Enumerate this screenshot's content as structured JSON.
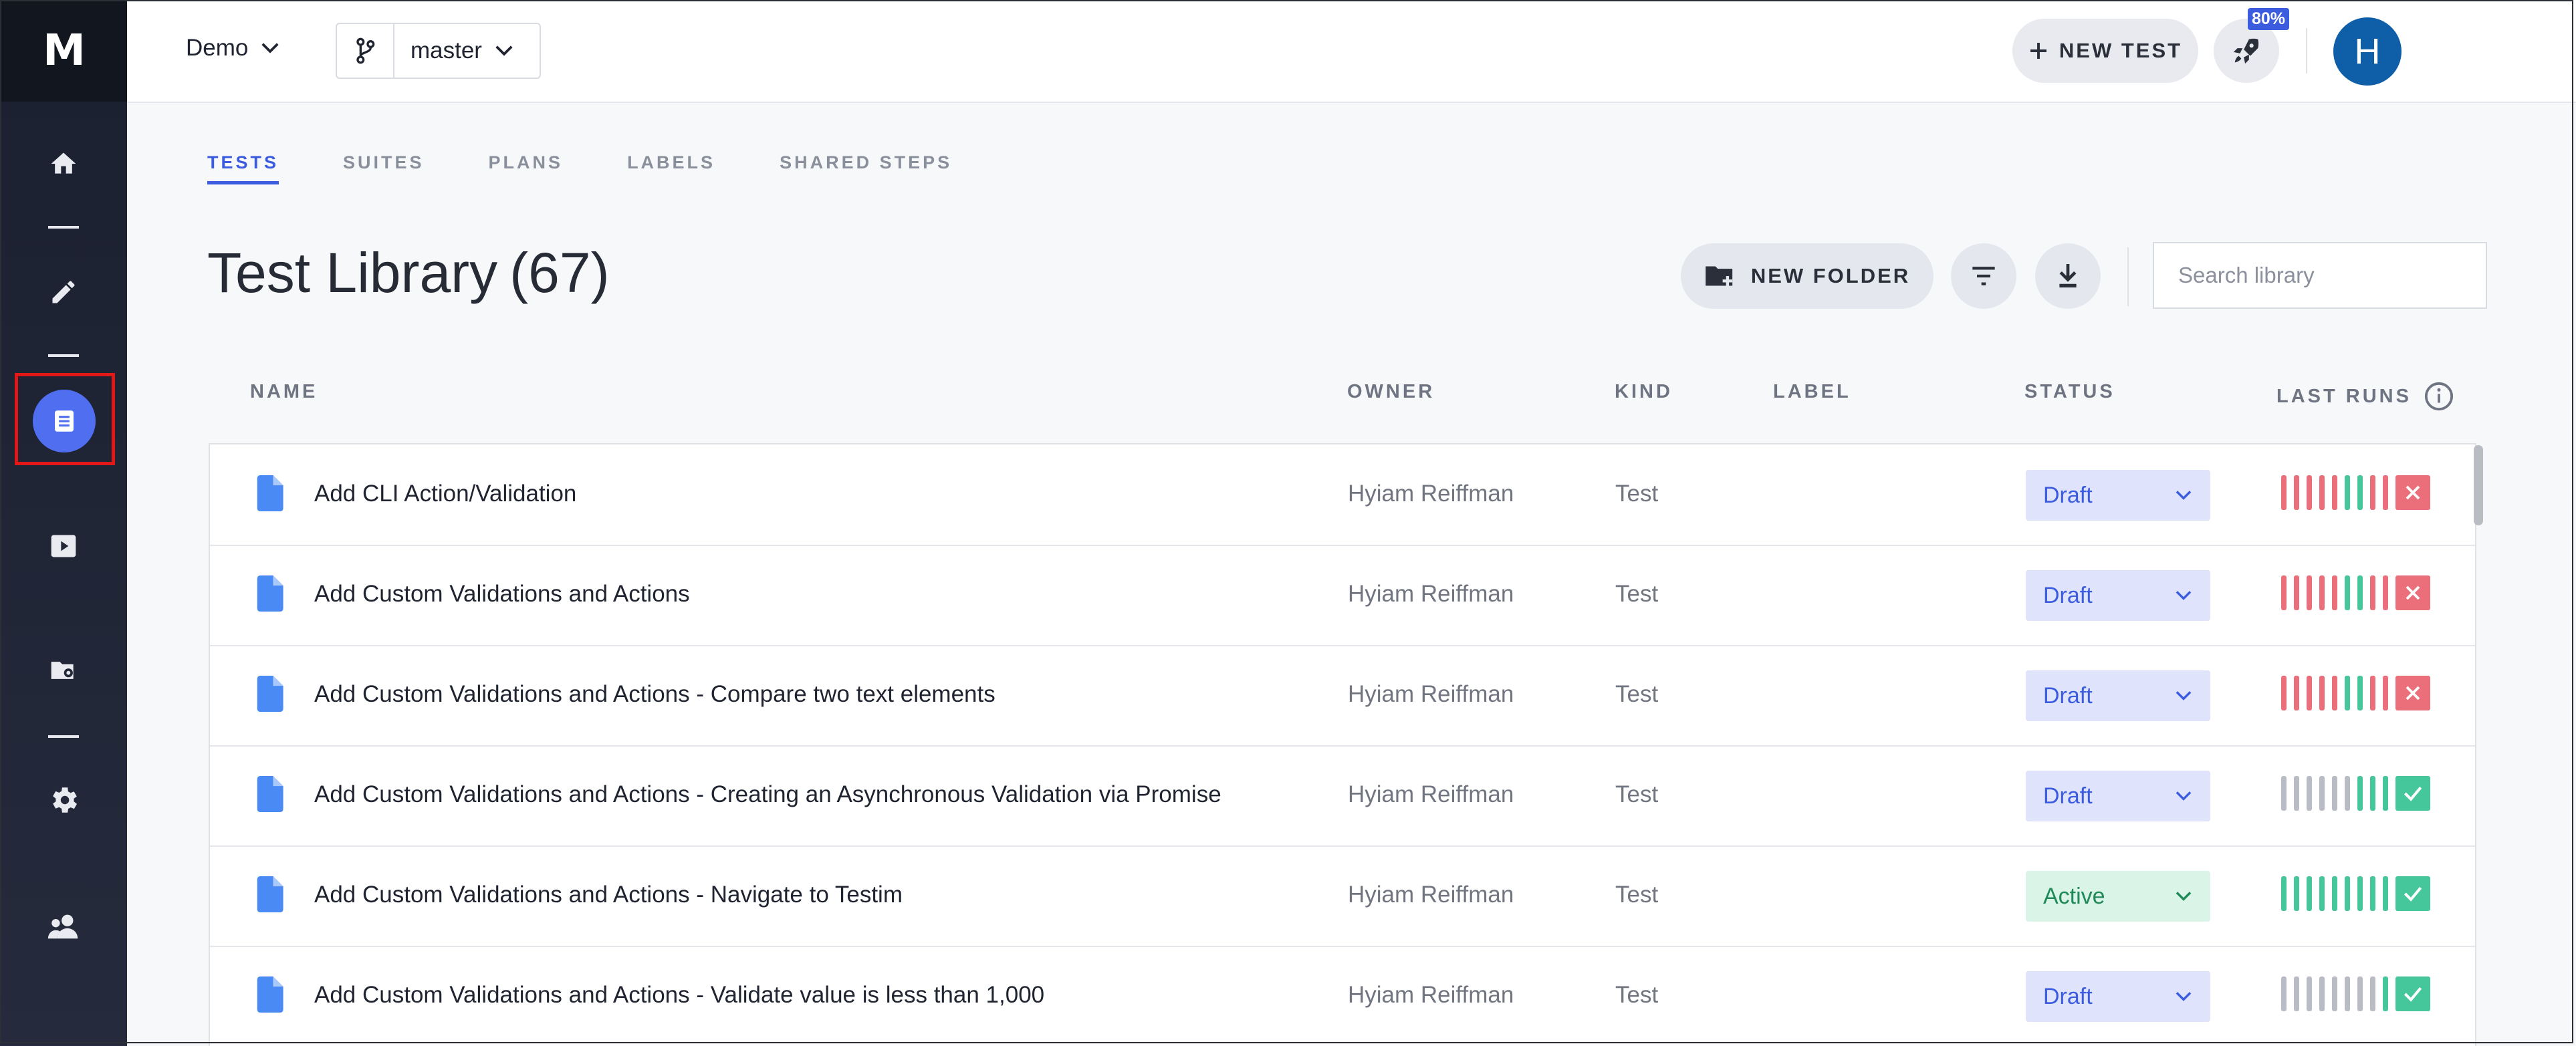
{
  "app": {
    "logo": "M"
  },
  "sidebar": {
    "items": [
      {
        "icon": "home-icon"
      },
      {
        "icon": "pencil-icon"
      },
      {
        "icon": "test-list-icon",
        "active": true
      },
      {
        "icon": "play-icon"
      },
      {
        "icon": "folder-settings-icon"
      },
      {
        "icon": "gear-icon"
      },
      {
        "icon": "team-icon"
      }
    ]
  },
  "topbar": {
    "project": "Demo",
    "branch": "master",
    "new_test_label": "NEW TEST",
    "badge": "80%",
    "avatar_initial": "H"
  },
  "tabs": [
    {
      "label": "TESTS",
      "active": true
    },
    {
      "label": "SUITES"
    },
    {
      "label": "PLANS"
    },
    {
      "label": "LABELS"
    },
    {
      "label": "SHARED STEPS"
    }
  ],
  "library": {
    "title": "Test Library",
    "count": "(67)",
    "new_folder_label": "NEW FOLDER",
    "search_placeholder": "Search library"
  },
  "table": {
    "headers": {
      "name": "NAME",
      "owner": "OWNER",
      "kind": "KIND",
      "label": "LABEL",
      "status": "STATUS",
      "last_runs": "LAST RUNS"
    },
    "rows": [
      {
        "name": "Add CLI Action/Validation",
        "owner": "Hyiam Reiffman",
        "kind": "Test",
        "status": "Draft",
        "runs": "fffffppff",
        "last": "fail"
      },
      {
        "name": "Add Custom Validations and Actions",
        "owner": "Hyiam Reiffman",
        "kind": "Test",
        "status": "Draft",
        "runs": "fffffppff",
        "last": "fail"
      },
      {
        "name": "Add Custom Validations and Actions - Compare two text elements",
        "owner": "Hyiam Reiffman",
        "kind": "Test",
        "status": "Draft",
        "runs": "fffffppff",
        "last": "fail"
      },
      {
        "name": "Add Custom Validations and Actions - Creating an Asynchronous Validation via Promise",
        "owner": "Hyiam Reiffman",
        "kind": "Test",
        "status": "Draft",
        "runs": "nnnnnnppp",
        "last": "pass"
      },
      {
        "name": "Add Custom Validations and Actions - Navigate to Testim",
        "owner": "Hyiam Reiffman",
        "kind": "Test",
        "status": "Active",
        "runs": "ppppppppp",
        "last": "pass"
      },
      {
        "name": "Add Custom Validations and Actions - Validate value is less than 1,000",
        "owner": "Hyiam Reiffman",
        "kind": "Test",
        "status": "Draft",
        "runs": "nnnnnnnnp",
        "last": "pass"
      }
    ]
  }
}
